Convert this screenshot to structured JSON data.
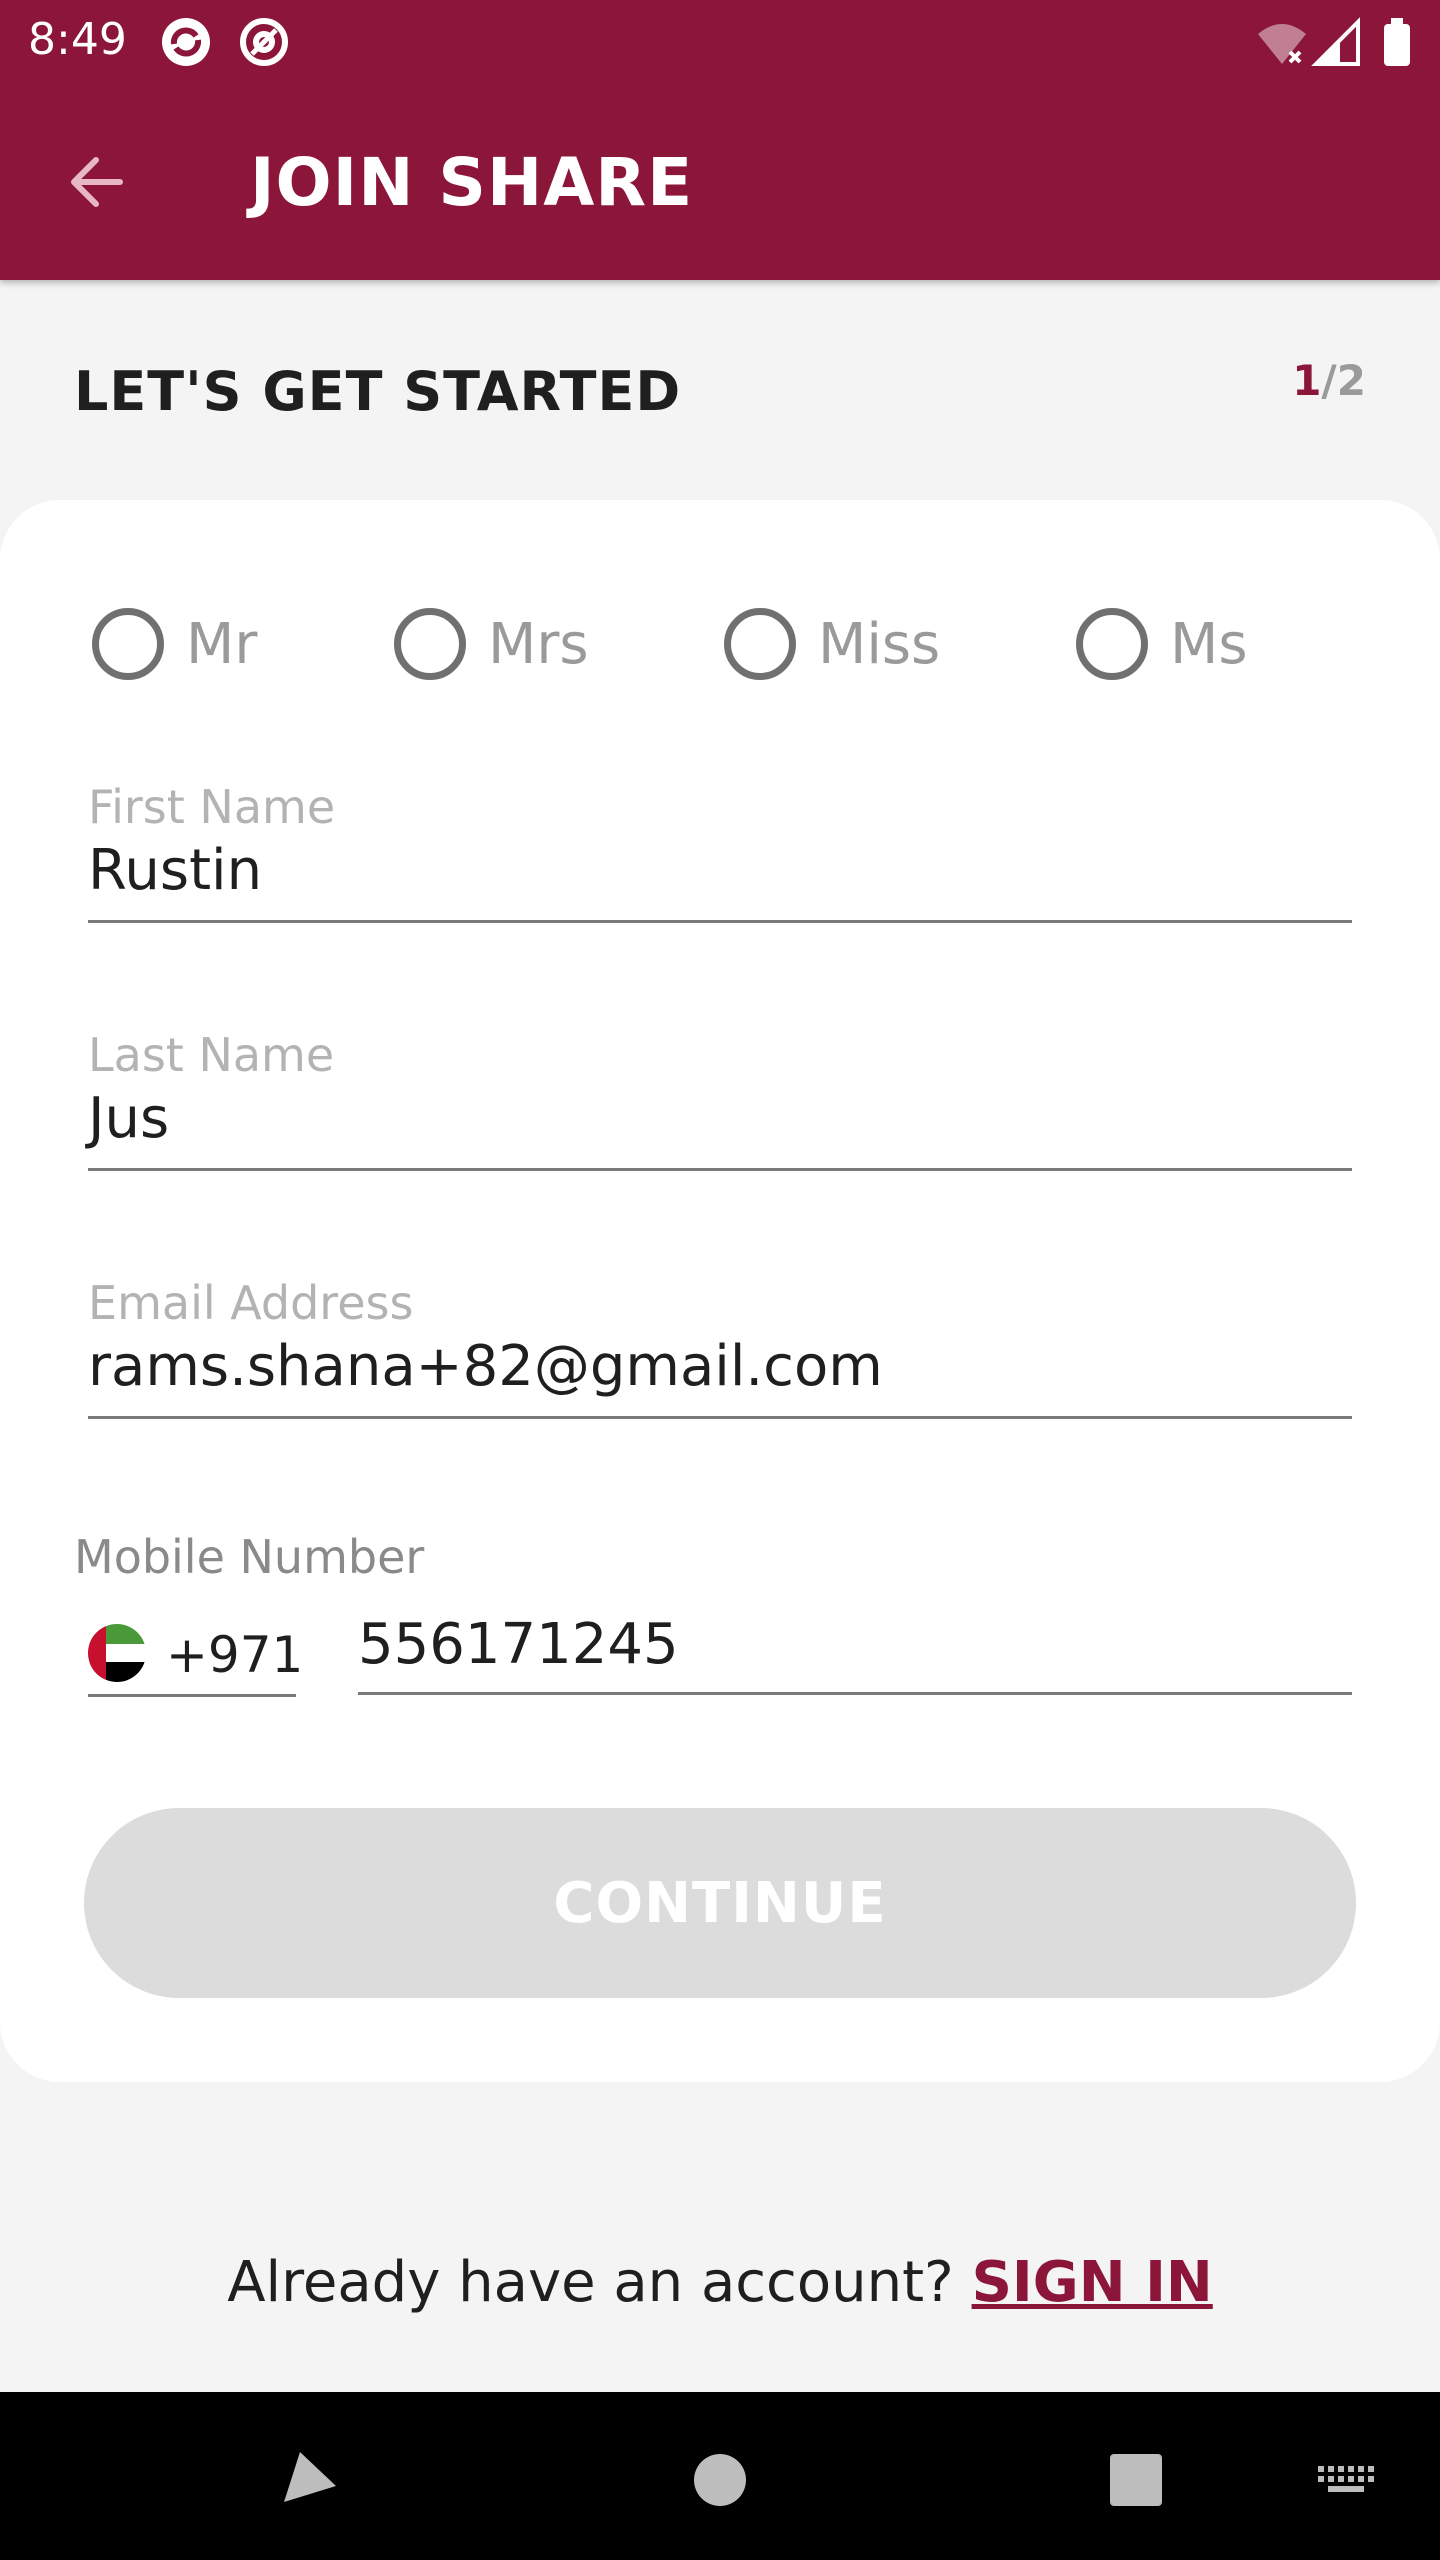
{
  "status_bar": {
    "time": "8:49"
  },
  "app_bar": {
    "title": "JOIN SHARE"
  },
  "page": {
    "heading": "LET'S GET STARTED",
    "step_current": "1",
    "step_total": "/2"
  },
  "salutations": [
    {
      "label": "Mr",
      "selected": false
    },
    {
      "label": "Mrs",
      "selected": false
    },
    {
      "label": "Miss",
      "selected": false
    },
    {
      "label": "Ms",
      "selected": false
    }
  ],
  "form": {
    "first_name": {
      "label": "First Name",
      "value": "Rustin"
    },
    "last_name": {
      "label": "Last Name",
      "value": "Jus"
    },
    "email": {
      "label": "Email Address",
      "value": "rams.shana+82@gmail.com"
    },
    "mobile": {
      "label": "Mobile Number",
      "country_code": "+971",
      "number": "556171245"
    }
  },
  "continue_label": "CONTINUE",
  "footer": {
    "prompt": "Already have an account? ",
    "link": "SIGN IN"
  },
  "colors": {
    "brand": "#8c1639",
    "disabled_button": "#dcdcdc"
  }
}
